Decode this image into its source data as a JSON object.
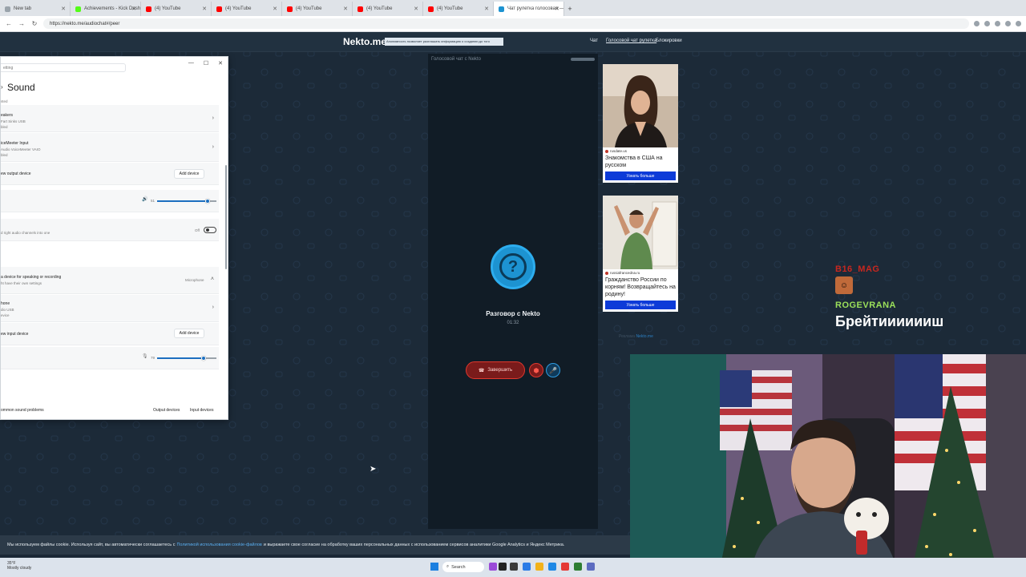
{
  "browser": {
    "tabs": [
      {
        "label": "New tab",
        "color": "#9aa3ab",
        "active": false
      },
      {
        "label": "Achievements - Kick Dashboard",
        "color": "#53fc18",
        "active": false
      },
      {
        "label": "(4) YouTube",
        "color": "#ff0000",
        "active": false
      },
      {
        "label": "(4) YouTube",
        "color": "#ff0000",
        "active": false
      },
      {
        "label": "(4) YouTube",
        "color": "#ff0000",
        "active": false
      },
      {
        "label": "(4) YouTube",
        "color": "#ff0000",
        "active": false
      },
      {
        "label": "(4) YouTube",
        "color": "#ff0000",
        "active": false
      },
      {
        "label": "Чат рулетка голосовая — Nekto",
        "color": "#1d93d1",
        "active": true
      }
    ],
    "url": "https://nekto.me/audiochat#/peer",
    "new_tab_glyph": "+"
  },
  "site": {
    "logo": "Nekto.me",
    "tagline": "Анонимность позволяет разглашать информацию о создании до того",
    "nav": [
      "Чат",
      "Голосовой чат рулетка",
      "Блокировки"
    ]
  },
  "chat": {
    "header": "Голосовой чат с Nekto",
    "peer_name": "Разговор с Nekto",
    "timer": "01:32",
    "end_label": "Завершить",
    "avatar_glyph": "?"
  },
  "ads": [
    {
      "source": "rusdate.us",
      "title": "Знакомства в США на русском",
      "button": "Узнать больше"
    },
    {
      "source": "russiafrancedna.ru",
      "title": "Гражданство России по корням! Возвращайтесь на родину!",
      "button": "Узнать больше"
    }
  ],
  "ad_footer": {
    "label": "Реклама",
    "link": "Nekto.me"
  },
  "settings": {
    "search_placeholder": "etting",
    "title": "Sound",
    "output_header": "sted",
    "devices": [
      {
        "name": "eakers",
        "sub": "Fart Sinks USB",
        "sub2": "bled"
      },
      {
        "name": "iceMeeter Input",
        "sub": "Audio VoiceMeeter VAIO",
        "sub2": "bled"
      }
    ],
    "pair_output": "ew output device",
    "add_device": "Add device",
    "volume_out": "51",
    "volume_out_level": 0.85,
    "mono_text": "d right audio channels into one",
    "mono_state": "Off",
    "input_header": "a device for speaking or recording",
    "input_sub": "ht have their own settings",
    "input_header_value": "Microphone",
    "input_device": {
      "name": "hone",
      "sub": "dio USB",
      "sub2": "evice"
    },
    "pair_input": "ew input device",
    "volume_in": "79",
    "volume_in_level": 0.79,
    "more_label": "ommon sound problems",
    "output_link": "Output devices",
    "input_link": "Input devices"
  },
  "cookie": {
    "before": "Мы используем файлы cookie. Используя сайт, вы автоматически соглашаетесь с",
    "link": "Политикой использования cookie-файлов",
    "after": "и выражаете свое согласие на обработку ваших персональных данных с использованием сервисов аналитики Google Analytics и Яндекс Метрика."
  },
  "taskbar": {
    "temp": "35°F",
    "weather": "Mostly cloudy",
    "search": "Search"
  },
  "overlay": {
    "user1": "B16_MAG",
    "user2": "ROGEVRANA",
    "message": "Брейтииииииш"
  }
}
